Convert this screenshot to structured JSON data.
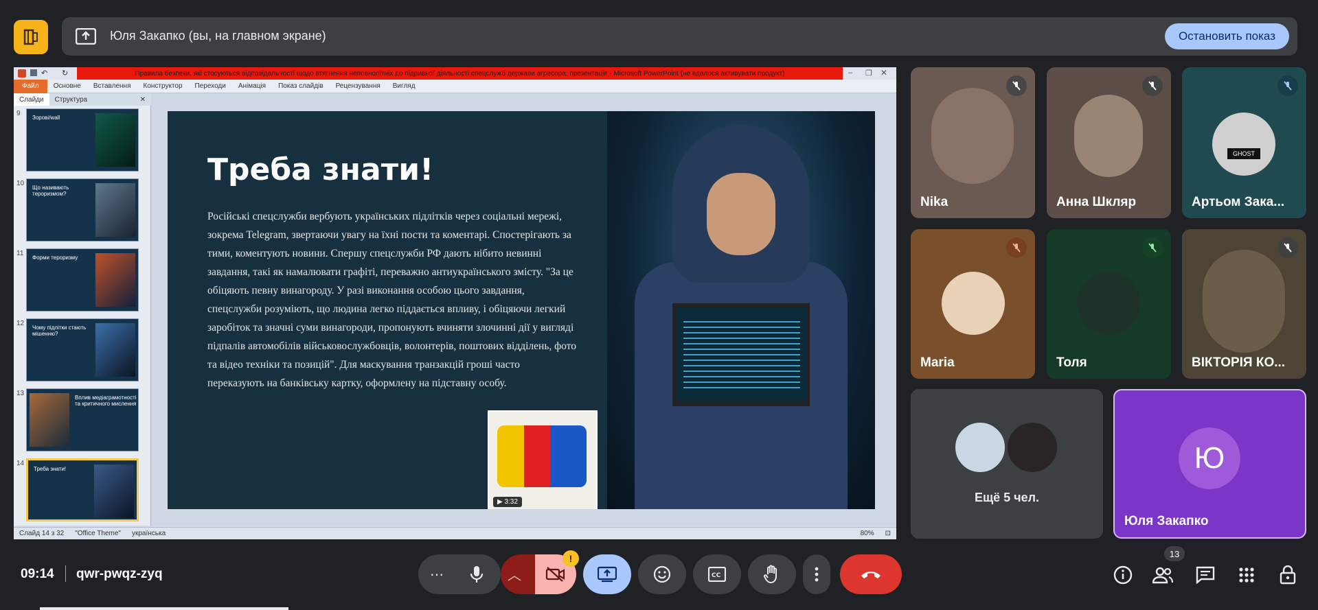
{
  "banner": {
    "presenting_text": "Юля Закапко (вы, на главном экране)",
    "stop_button": "Остановить показ"
  },
  "ppt": {
    "window_title": "Правила безпеки, які стосуються відповідальності щодо втягнення неповнолітніх до підривної діяльності спецслужб держави агресора. презентація - Microsoft PowerPoint (не вдалося активувати продукт)",
    "ribbon_tabs": [
      "Файл",
      "Основне",
      "Вставлення",
      "Конструктор",
      "Переходи",
      "Анімація",
      "Показ слайдів",
      "Рецензування",
      "Вигляд"
    ],
    "panel_tabs": [
      "Слайди",
      "Структура"
    ],
    "thumbnails": [
      {
        "num": "9",
        "title": "Зорові/wall"
      },
      {
        "num": "10",
        "title": "Що називають тероризмом?"
      },
      {
        "num": "11",
        "title": "Форми тероризму"
      },
      {
        "num": "12",
        "title": "Чому підлітки стають мішенню?"
      },
      {
        "num": "13",
        "title": "Вплив медіаграмотності та критичного мислення"
      },
      {
        "num": "14",
        "title": "Треба знати!"
      }
    ],
    "status": {
      "slide_of": "Слайд 14 з 32",
      "theme": "\"Office Theme\"",
      "language": "українська",
      "zoom": "80%"
    }
  },
  "slide": {
    "title": "Треба знати!",
    "body": "Російські спецслужби вербують українських підлітків через соціальні мережі, зокрема Telegram, звертаючи увагу на їхні пости та коментарі. Спостерігають за тими, коментують новини. Спершу спецслужби РФ дають нібито невинні завдання, такі як намалювати графіті, переважно антиукраїнського змісту. \"За це обіцяють певну винагороду. У разі виконання особою цього завдання, спецслужби розуміють, що людина легко піддається впливу, і обіцяючи легкий заробіток та значні суми винагороди, пропонують вчиняти злочинні дії у вигляді підпалів автомобілів військовослужбовців, волонтерів, поштових відділень, фото та відео техніки та позицій\". Для маскування транзакцій гроші часто переказують на банківську картку, оформлену на підставну особу.",
    "video_time": "3:32"
  },
  "participants": [
    {
      "name": "Nika",
      "muted": true,
      "bg": "#6b5a52"
    },
    {
      "name": "Анна Шкляр",
      "muted": true,
      "bg": "#5c4e46"
    },
    {
      "name": "Артьом Зака...",
      "muted": true,
      "bg": "#1f4a4f"
    },
    {
      "name": "Maria",
      "muted": true,
      "bg": "#7a4f2c"
    },
    {
      "name": "Толя",
      "muted": true,
      "bg": "#163a28"
    },
    {
      "name": "ВІКТОРІЯ КО...",
      "muted": true,
      "bg": "#4d4436"
    }
  ],
  "more_tile": {
    "label": "Ещё 5 чел."
  },
  "self_tile": {
    "initial": "Ю",
    "name": "Юля Закапко"
  },
  "bottombar": {
    "time": "09:14",
    "meeting_code": "qwr-pwqz-zyq",
    "people_count": "13"
  },
  "colors": {
    "accent_blue": "#a8c7fa",
    "end_call_red": "#ea4335",
    "self_tile_purple": "#7b35c7",
    "camera_off_pink": "#f9b3b0"
  }
}
